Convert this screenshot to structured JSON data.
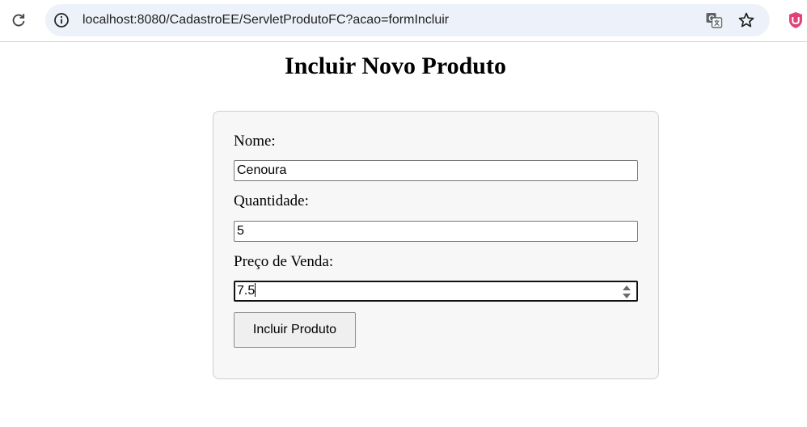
{
  "browser": {
    "url": "localhost:8080/CadastroEE/ServletProdutoFC?acao=formIncluir",
    "icons": [
      "reload-icon",
      "site-info-icon",
      "translate-icon",
      "bookmark-star-icon",
      "extension-shield-icon"
    ]
  },
  "page": {
    "title": "Incluir Novo Produto"
  },
  "form": {
    "nome_label": "Nome:",
    "nome_value": "Cenoura",
    "quantidade_label": "Quantidade:",
    "quantidade_value": "5",
    "preco_label": "Preço de Venda:",
    "preco_value": "7.5",
    "submit_label": "Incluir Produto"
  },
  "colors": {
    "omnibox_bg": "#edf2fa",
    "form_bg": "#f7f7f7",
    "extension_accent": "#e0427a"
  }
}
